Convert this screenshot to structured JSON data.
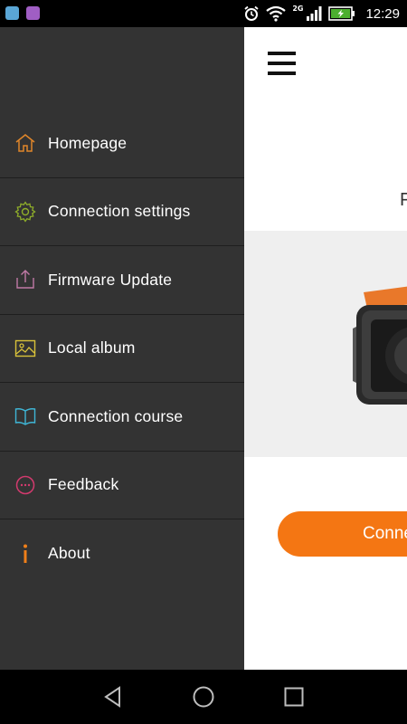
{
  "status_bar": {
    "time": "12:29",
    "network": "2G",
    "icons": [
      "app-notification-icon",
      "gallery-notification-icon",
      "alarm-icon",
      "wifi-icon",
      "signal-icon",
      "battery-charging-icon"
    ]
  },
  "main": {
    "partial_text": "F",
    "connect_button_label": "Conne"
  },
  "drawer": {
    "items": [
      {
        "label": "Homepage",
        "icon": "home-icon",
        "color": "#e0862a"
      },
      {
        "label": "Connection settings",
        "icon": "gear-icon",
        "color": "#8fae2a"
      },
      {
        "label": "Firmware Update",
        "icon": "upload-icon",
        "color": "#c07aa6"
      },
      {
        "label": "Local album",
        "icon": "image-icon",
        "color": "#d9c23a"
      },
      {
        "label": "Connection course",
        "icon": "book-icon",
        "color": "#3fb6d6"
      },
      {
        "label": "Feedback",
        "icon": "chat-icon",
        "color": "#d33a6e"
      },
      {
        "label": "About",
        "icon": "info-icon",
        "color": "#f07f19"
      }
    ]
  },
  "colors": {
    "drawer_bg": "#333333",
    "accent": "#f47613"
  }
}
